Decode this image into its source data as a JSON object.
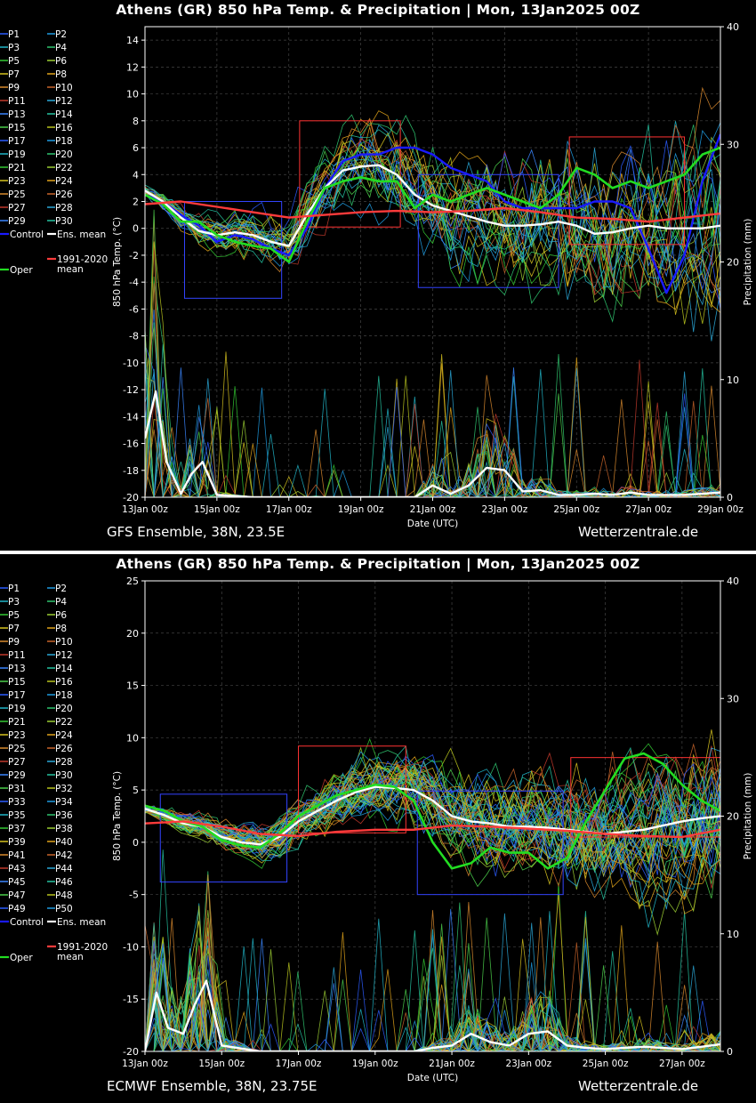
{
  "panels": [
    {
      "id": "gfs",
      "title": "Athens  (GR)  850 hPa Temp. & Precipitation | Mon, 13Jan2025 00Z",
      "model": "GFS Ensemble, 38N, 23.5E",
      "site": "Wetterzentrale.de",
      "members": 30,
      "legend_labels": [
        "P1",
        "P2",
        "P3",
        "P4",
        "P5",
        "P6",
        "P7",
        "P8",
        "P9",
        "P10",
        "P11",
        "P12",
        "P13",
        "P14",
        "P15",
        "P16",
        "P17",
        "P18",
        "P19",
        "P20",
        "P21",
        "P22",
        "P23",
        "P24",
        "P25",
        "P26",
        "P27",
        "P28",
        "P29",
        "P30"
      ],
      "legend_extra": {
        "control": "Control",
        "mean": "Ens. mean",
        "oper": "Oper",
        "clim_1": "1991-2020",
        "clim_2": "mean"
      }
    },
    {
      "id": "ecmwf",
      "title": "Athens  (GR)  850 hPa Temp. & Precipitation | Mon, 13Jan2025 00Z",
      "model": "ECMWF Ensemble, 38N, 23.75E",
      "site": "Wetterzentrale.de",
      "members": 50,
      "legend_labels": [
        "P1",
        "P2",
        "P3",
        "P4",
        "P5",
        "P6",
        "P7",
        "P8",
        "P9",
        "P10",
        "P11",
        "P12",
        "P13",
        "P14",
        "P15",
        "P16",
        "P17",
        "P18",
        "P19",
        "P20",
        "P21",
        "P22",
        "P23",
        "P24",
        "P25",
        "P26",
        "P27",
        "P28",
        "P29",
        "P30",
        "P31",
        "P32",
        "P33",
        "P34",
        "P35",
        "P36",
        "P37",
        "P38",
        "P39",
        "P40",
        "P41",
        "P42",
        "P43",
        "P44",
        "P45",
        "P46",
        "P47",
        "P48",
        "P49",
        "P50"
      ],
      "legend_extra": {
        "control": "Control",
        "mean": "Ens. mean",
        "oper": "Oper",
        "clim_1": "1991-2020",
        "clim_2": "mean"
      }
    }
  ],
  "colors": {
    "control": "#1a1aff",
    "mean": "#ffffff",
    "oper": "#22dd22",
    "clim": "#ff3b3b",
    "member_palette": [
      "#2b5cff",
      "#1f9be0",
      "#21b6c9",
      "#2fc46f",
      "#33c933",
      "#9acd32",
      "#d6c21f",
      "#e0a31a",
      "#d98a2e",
      "#c8642a",
      "#c0392b",
      "#2aa8d8",
      "#3a86ff",
      "#25c2a0",
      "#4bcf4b",
      "#b8c41e"
    ],
    "box_blue": "#3344ff",
    "box_red": "#ff3333"
  },
  "chart_data": [
    {
      "type": "line",
      "title": "Athens  (GR)  850 hPa Temp. & Precipitation | Mon, 13Jan2025 00Z",
      "xlabel": "Date (UTC)",
      "ylabel": "850 hPa Temp. (°C)",
      "y2label": "Precipitation (mm)",
      "xlim": [
        0,
        16
      ],
      "ylim": [
        -20,
        15
      ],
      "y2lim": [
        0,
        40
      ],
      "yticks": [
        -20,
        -18,
        -16,
        -14,
        -12,
        -10,
        -8,
        -6,
        -4,
        -2,
        0,
        2,
        4,
        6,
        8,
        10,
        12,
        14
      ],
      "y2ticks": [
        0,
        10,
        20,
        30,
        40
      ],
      "xticks": [
        0,
        2,
        4,
        6,
        8,
        10,
        12,
        14,
        16
      ],
      "xtick_labels": [
        "13Jan 00z",
        "15Jan 00z",
        "17Jan 00z",
        "19Jan 00z",
        "21Jan 00z",
        "23Jan 00z",
        "25Jan 00z",
        "27Jan 00z",
        "29Jan 00z"
      ],
      "grid": true,
      "legend_position": "left",
      "series": [
        {
          "name": "Control",
          "kind": "temp",
          "x": [
            0,
            0.5,
            1,
            1.5,
            2,
            2.5,
            3,
            3.5,
            4,
            4.5,
            5,
            5.5,
            6,
            6.5,
            7,
            7.5,
            8,
            8.5,
            9,
            9.5,
            10,
            10.5,
            11,
            11.5,
            12,
            12.5,
            13,
            13.5,
            14,
            14.5,
            15,
            15.5,
            16
          ],
          "y": [
            2.5,
            2,
            1,
            0.2,
            -1,
            -0.5,
            -0.8,
            -1.5,
            -2,
            0,
            3,
            5,
            5.5,
            5.5,
            6,
            6,
            5.5,
            4.5,
            4,
            3.5,
            2,
            1.5,
            1.5,
            1.5,
            1.5,
            2,
            2,
            1.5,
            -1.5,
            -4.8,
            -2,
            3.5,
            7
          ]
        },
        {
          "name": "Ens. mean",
          "kind": "temp",
          "x": [
            0,
            0.5,
            1,
            1.5,
            2,
            2.5,
            3,
            3.5,
            4,
            4.5,
            5,
            5.5,
            6,
            6.5,
            7,
            7.5,
            8,
            8.5,
            9,
            9.5,
            10,
            10.5,
            11,
            11.5,
            12,
            12.5,
            13,
            13.5,
            14,
            14.5,
            15,
            15.5,
            16
          ],
          "y": [
            2.8,
            2,
            0.8,
            -0.2,
            -0.5,
            -0.3,
            -0.5,
            -1,
            -1.3,
            1,
            3,
            4.3,
            4.6,
            4.7,
            4,
            2.5,
            1.7,
            1.3,
            0.9,
            0.5,
            0.2,
            0.2,
            0.3,
            0.5,
            0.2,
            -0.4,
            -0.3,
            0,
            0.2,
            0,
            0,
            0,
            0.2
          ]
        },
        {
          "name": "Oper",
          "kind": "temp",
          "x": [
            0,
            0.5,
            1,
            1.5,
            2,
            2.5,
            3,
            3.5,
            4,
            4.5,
            5,
            5.5,
            6,
            6.5,
            7,
            7.5,
            8,
            8.5,
            9,
            9.5,
            10,
            10.5,
            11,
            11.5,
            12,
            12.5,
            13,
            13.5,
            14,
            14.5,
            15,
            15.5,
            16
          ],
          "y": [
            2.5,
            1.8,
            0.5,
            0.5,
            -0.5,
            -1,
            -1.3,
            -1.5,
            -2.5,
            0.5,
            3,
            3.5,
            3.8,
            3.5,
            3.5,
            1.5,
            2.5,
            2,
            2.5,
            3,
            2.5,
            2,
            1.5,
            2.5,
            4.5,
            4,
            3,
            3.5,
            3,
            3.5,
            4,
            5.5,
            6
          ]
        },
        {
          "name": "1991-2020 mean",
          "kind": "temp",
          "x": [
            0,
            1,
            2,
            3,
            4,
            5,
            6,
            7,
            8,
            9,
            10,
            11,
            12,
            13,
            14,
            15,
            16
          ],
          "y": [
            1.8,
            2,
            1.6,
            1.2,
            0.8,
            1,
            1.2,
            1.3,
            1.2,
            1.3,
            1.5,
            1.2,
            0.8,
            0.7,
            0.5,
            0.8,
            1.1
          ]
        },
        {
          "name": "Ens. mean precip",
          "kind": "precip",
          "x": [
            0,
            0.3,
            0.6,
            1,
            1.3,
            1.6,
            2,
            3,
            4,
            5,
            6,
            7,
            7.5,
            8,
            8.5,
            9,
            9.5,
            10,
            10.5,
            11,
            11.5,
            12,
            12.5,
            13,
            13.5,
            14,
            15,
            16
          ],
          "y": [
            5,
            9,
            3,
            0.3,
            2,
            3,
            0.2,
            0,
            0,
            0,
            0,
            0,
            0,
            1,
            0.3,
            1,
            2.5,
            2.3,
            0.5,
            0.6,
            0.2,
            0.2,
            0.3,
            0.2,
            0.4,
            0.2,
            0.2,
            0.4
          ]
        }
      ]
    },
    {
      "type": "line",
      "title": "Athens  (GR)  850 hPa Temp. & Precipitation | Mon, 13Jan2025 00Z",
      "xlabel": "Date (UTC)",
      "ylabel": "850 hPa Temp. (°C)",
      "y2label": "Precipitation (mm)",
      "xlim": [
        0,
        15
      ],
      "ylim": [
        -20,
        25
      ],
      "y2lim": [
        0,
        40
      ],
      "yticks": [
        -20,
        -15,
        -10,
        -5,
        0,
        5,
        10,
        15,
        20,
        25
      ],
      "y2ticks": [
        0,
        10,
        20,
        30,
        40
      ],
      "xticks": [
        0,
        2,
        4,
        6,
        8,
        10,
        12,
        14
      ],
      "xtick_labels": [
        "13Jan 00z",
        "15Jan 00z",
        "17Jan 00z",
        "19Jan 00z",
        "21Jan 00z",
        "23Jan 00z",
        "25Jan 00z",
        "27Jan 00z"
      ],
      "grid": true,
      "legend_position": "left",
      "series": [
        {
          "name": "Ens. mean",
          "kind": "temp",
          "x": [
            0,
            0.5,
            1,
            1.5,
            2,
            2.5,
            3,
            3.5,
            4,
            4.5,
            5,
            5.5,
            6,
            6.5,
            7,
            7.5,
            8,
            8.5,
            9,
            9.5,
            10,
            10.5,
            11,
            11.5,
            12,
            12.5,
            13,
            13.5,
            14,
            14.5,
            15
          ],
          "y": [
            3.2,
            2.6,
            1.8,
            1.5,
            0.5,
            0,
            -0.2,
            0.5,
            2,
            3,
            4,
            4.8,
            5.3,
            5.2,
            5,
            4,
            2.5,
            2,
            1.8,
            1.5,
            1.5,
            1.4,
            1.2,
            1,
            0.8,
            1,
            1.2,
            1.6,
            2,
            2.3,
            2.5
          ]
        },
        {
          "name": "Oper",
          "kind": "temp",
          "x": [
            0,
            0.5,
            1,
            1.5,
            2,
            2.5,
            3,
            3.5,
            4,
            4.5,
            5,
            5.5,
            6,
            6.5,
            7,
            7.5,
            8,
            8.5,
            9,
            9.5,
            10,
            10.5,
            11,
            11.5,
            12,
            12.5,
            13,
            13.5,
            14,
            14.5,
            15
          ],
          "y": [
            3.5,
            3,
            2,
            1.5,
            0.2,
            -0.3,
            -0.5,
            0.8,
            2.5,
            3.5,
            4.5,
            5,
            5.5,
            5.3,
            4,
            0,
            -2.5,
            -2,
            -0.5,
            -1,
            -1,
            -2.5,
            -1.5,
            2,
            5,
            8,
            8.5,
            7.5,
            5.5,
            4,
            3
          ]
        },
        {
          "name": "1991-2020 mean",
          "kind": "temp",
          "x": [
            0,
            1,
            2,
            3,
            4,
            5,
            6,
            7,
            8,
            9,
            10,
            11,
            12,
            13,
            14,
            15
          ],
          "y": [
            1.8,
            2,
            1.5,
            0.8,
            0.6,
            1,
            1.2,
            1.2,
            1.6,
            1.5,
            1.3,
            1.1,
            0.8,
            0.6,
            0.5,
            1.2
          ]
        },
        {
          "name": "Ens. mean precip",
          "kind": "precip",
          "x": [
            0,
            0.3,
            0.6,
            1,
            1.3,
            1.6,
            2,
            3,
            4,
            5,
            6,
            7,
            7.5,
            8,
            8.5,
            9,
            9.5,
            10,
            10.5,
            11,
            11.5,
            12,
            12.5,
            13,
            14,
            15
          ],
          "y": [
            0,
            5,
            2,
            1.5,
            4,
            6,
            0.5,
            0,
            0,
            0,
            0,
            0,
            0.3,
            0.5,
            1.5,
            0.8,
            0.5,
            1.5,
            1.7,
            0.5,
            0.3,
            0.2,
            0.3,
            0.4,
            0.2,
            0.6
          ]
        }
      ]
    }
  ]
}
